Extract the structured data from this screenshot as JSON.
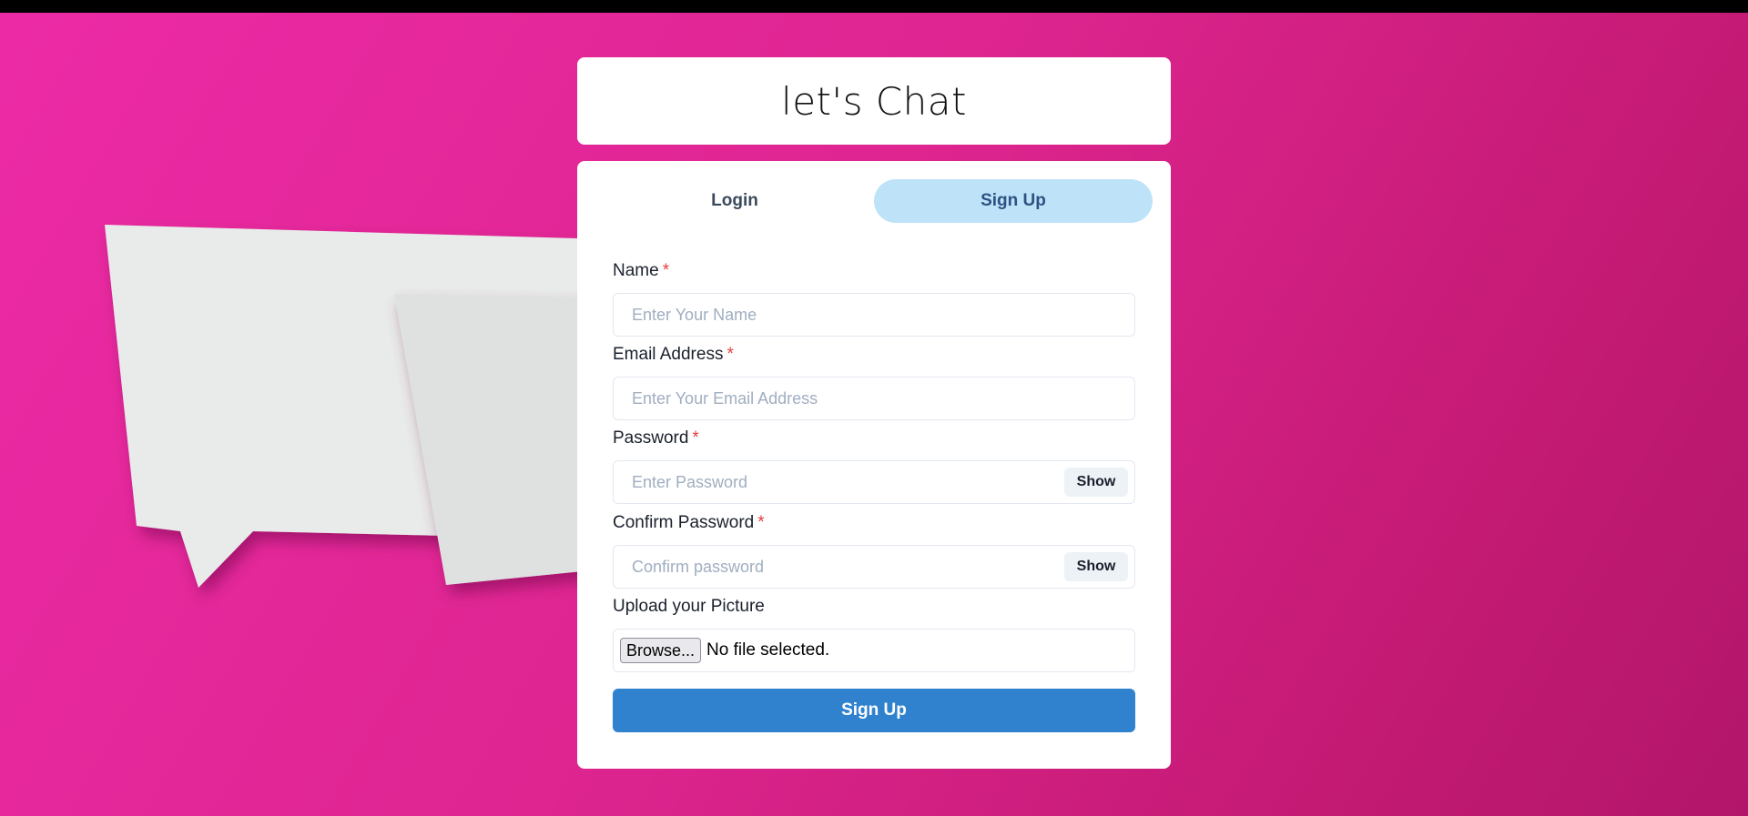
{
  "app": {
    "title": "let's Chat"
  },
  "tabs": [
    {
      "label": "Login",
      "active": false
    },
    {
      "label": "Sign Up",
      "active": true
    }
  ],
  "form": {
    "name": {
      "label": "Name",
      "required_mark": "*",
      "placeholder": "Enter Your Name",
      "value": ""
    },
    "email": {
      "label": "Email Address",
      "required_mark": "*",
      "placeholder": "Enter Your Email Address",
      "value": ""
    },
    "password": {
      "label": "Password",
      "required_mark": "*",
      "placeholder": "Enter Password",
      "value": "",
      "toggle_label": "Show"
    },
    "confirm_password": {
      "label": "Confirm Password",
      "required_mark": "*",
      "placeholder": "Confirm password",
      "value": "",
      "toggle_label": "Show"
    },
    "picture": {
      "label": "Upload your Picture",
      "browse_label": "Browse...",
      "status": "No file selected."
    },
    "submit_label": "Sign Up"
  },
  "colors": {
    "background": "#de2590",
    "tab_active_bg": "#bee3f8",
    "primary_button": "#3182ce",
    "required_mark": "#e53e3e"
  }
}
